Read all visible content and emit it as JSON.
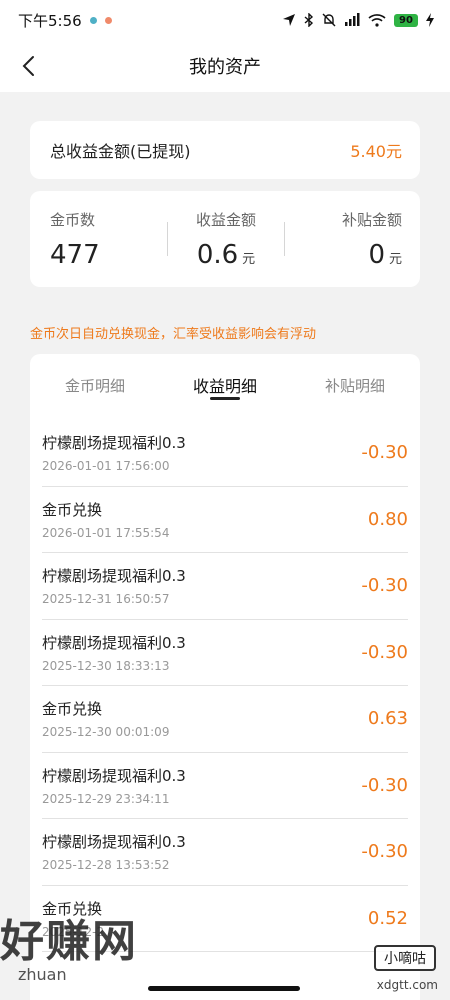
{
  "status_bar": {
    "time": "下午5:56",
    "battery": "90"
  },
  "nav": {
    "title": "我的资产"
  },
  "total": {
    "label": "总收益金额(已提现)",
    "value": "5.40元"
  },
  "stats": [
    {
      "label": "金币数",
      "value": "477",
      "unit": ""
    },
    {
      "label": "收益金额",
      "value": "0.6",
      "unit": "元"
    },
    {
      "label": "补贴金额",
      "value": "0",
      "unit": "元"
    }
  ],
  "notice": "金币次日自动兑换现金，汇率受收益影响会有浮动",
  "tabs": [
    {
      "label": "金币明细",
      "active": false
    },
    {
      "label": "收益明细",
      "active": true
    },
    {
      "label": "补贴明细",
      "active": false
    }
  ],
  "records": [
    {
      "title": "柠檬剧场提现福利0.3",
      "time": "2026-01-01 17:56:00",
      "amount": "-0.30"
    },
    {
      "title": "金币兑换",
      "time": "2026-01-01 17:55:54",
      "amount": "0.80"
    },
    {
      "title": "柠檬剧场提现福利0.3",
      "time": "2025-12-31 16:50:57",
      "amount": "-0.30"
    },
    {
      "title": "柠檬剧场提现福利0.3",
      "time": "2025-12-30 18:33:13",
      "amount": "-0.30"
    },
    {
      "title": "金币兑换",
      "time": "2025-12-30 00:01:09",
      "amount": "0.63"
    },
    {
      "title": "柠檬剧场提现福利0.3",
      "time": "2025-12-29 23:34:11",
      "amount": "-0.30"
    },
    {
      "title": "柠檬剧场提现福利0.3",
      "time": "2025-12-28 13:53:52",
      "amount": "-0.30"
    },
    {
      "title": "金币兑换",
      "time": "2025-12-2",
      "amount": "0.52"
    }
  ],
  "watermark": {
    "main": "好赚网",
    "sub": "zhuan",
    "badge": "小嘀咕",
    "badge_url": "xdgtt.com"
  },
  "colors": {
    "accent": "#ee7a1c",
    "background": "#f2f2f2",
    "card": "#ffffff"
  },
  "icons": {
    "back": "chevron-left-icon",
    "location": "location-icon",
    "bluetooth": "bluetooth-icon",
    "mute": "bell-off-icon",
    "signal": "signal-icon",
    "wifi": "wifi-icon",
    "charging": "bolt-icon"
  }
}
